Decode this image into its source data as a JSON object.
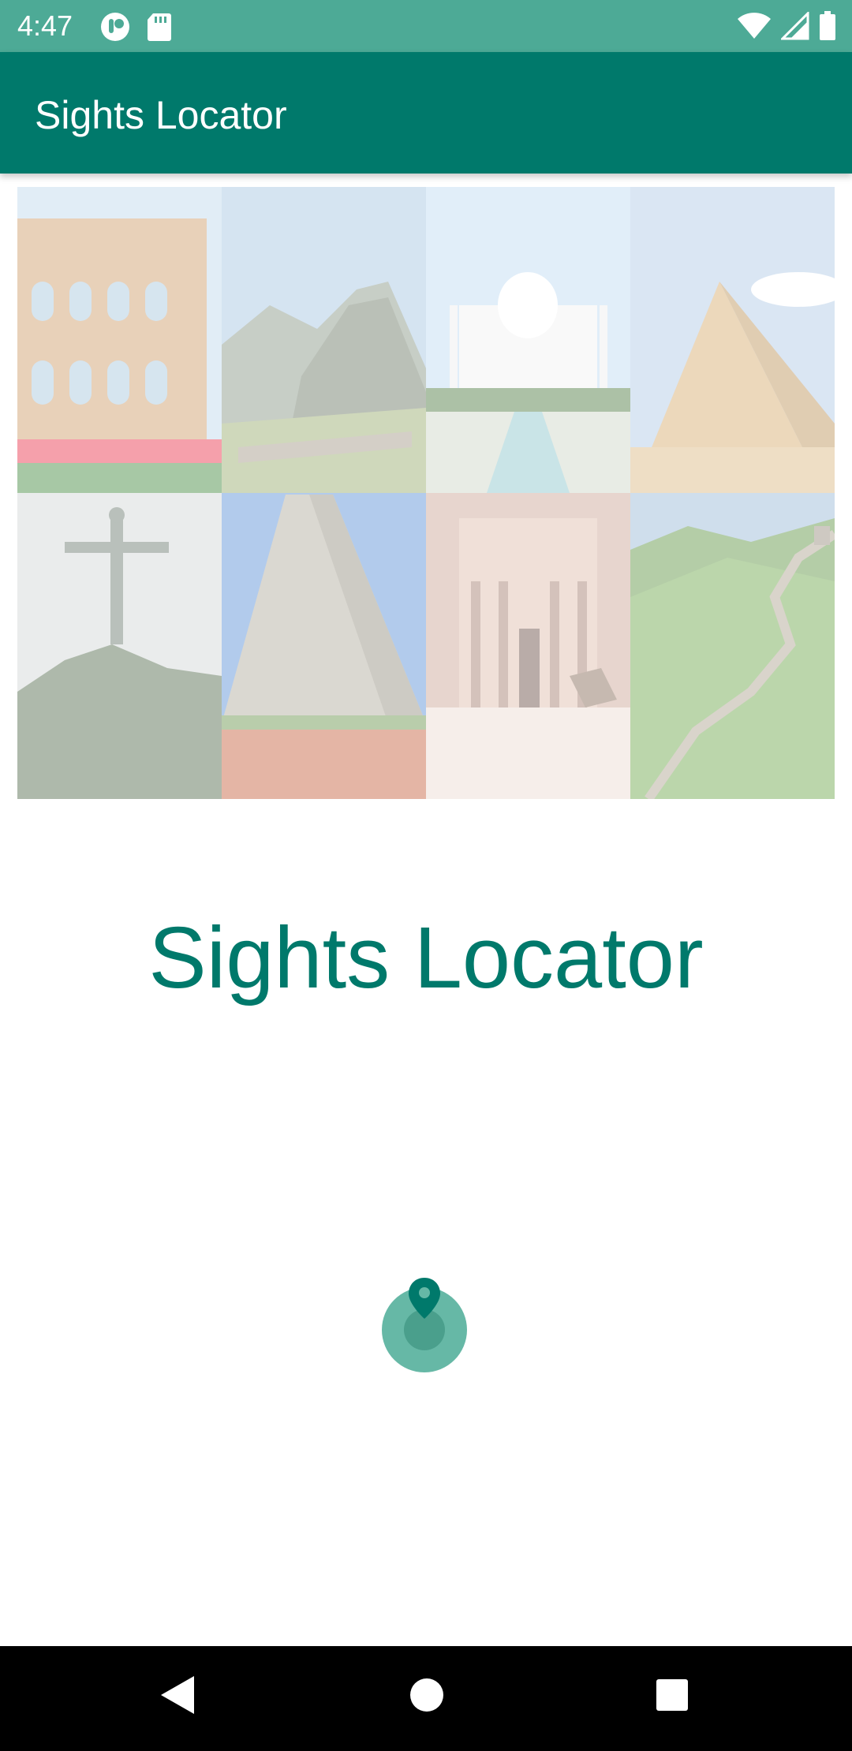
{
  "status_bar": {
    "time": "4:47",
    "left_icons": [
      "notification-app-icon",
      "sd-card-icon"
    ],
    "right_icons": [
      "wifi-icon",
      "cellular-signal-icon",
      "battery-icon"
    ],
    "background": "#4DAA96"
  },
  "app_bar": {
    "title": "Sights Locator",
    "background": "#00796B"
  },
  "collage": {
    "tiles": [
      "colosseum-image",
      "machu-picchu-image",
      "taj-mahal-image",
      "pyramids-giza-image",
      "christ-redeemer-image",
      "chichen-itza-image",
      "petra-image",
      "great-wall-image"
    ]
  },
  "splash": {
    "title": "Sights Locator",
    "accent": "#00796B"
  },
  "loader": {
    "icon": "location-pin-icon"
  },
  "nav_bar": {
    "buttons": [
      "back-icon",
      "home-icon",
      "recents-icon"
    ]
  }
}
